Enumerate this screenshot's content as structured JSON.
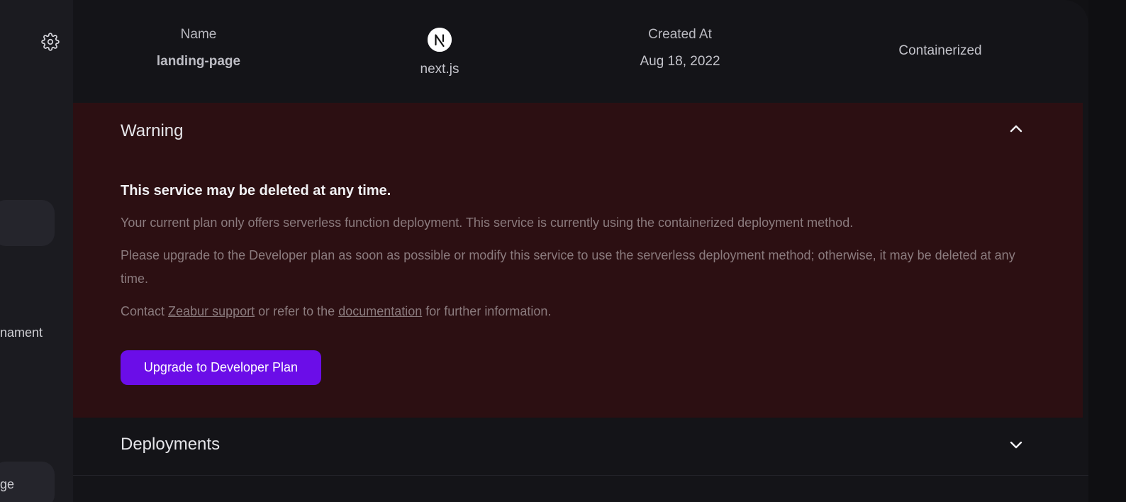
{
  "sidebar": {
    "settings_icon": "gear-icon",
    "partial_items": [
      "nament",
      "ge"
    ]
  },
  "service_info": {
    "name_label": "Name",
    "name_value": "landing-page",
    "framework_icon": "nextjs-logo",
    "framework_value": "next.js",
    "created_label": "Created At",
    "created_value": "Aug 18, 2022",
    "deployment_type": "Containerized"
  },
  "warning": {
    "title": "Warning",
    "heading": "This service may be deleted at any time.",
    "paragraph_1": "Your current plan only offers serverless function deployment. This service is currently using the containerized deployment method.",
    "paragraph_2": "Please upgrade to the Developer plan as soon as possible or modify this service to use the serverless deployment method; otherwise, it may be deleted at any time.",
    "contact_prefix": "Contact ",
    "support_link": "Zeabur support",
    "contact_middle": " or refer to the ",
    "docs_link": "documentation",
    "contact_suffix": " for further information.",
    "upgrade_button": "Upgrade to Developer Plan",
    "collapse_icon": "chevron-up-icon"
  },
  "deployments": {
    "title": "Deployments",
    "expand_icon": "chevron-down-icon"
  },
  "colors": {
    "warning_bg": "#2c0f12",
    "accent_button": "#6b0de8",
    "main_bg": "#141418"
  }
}
